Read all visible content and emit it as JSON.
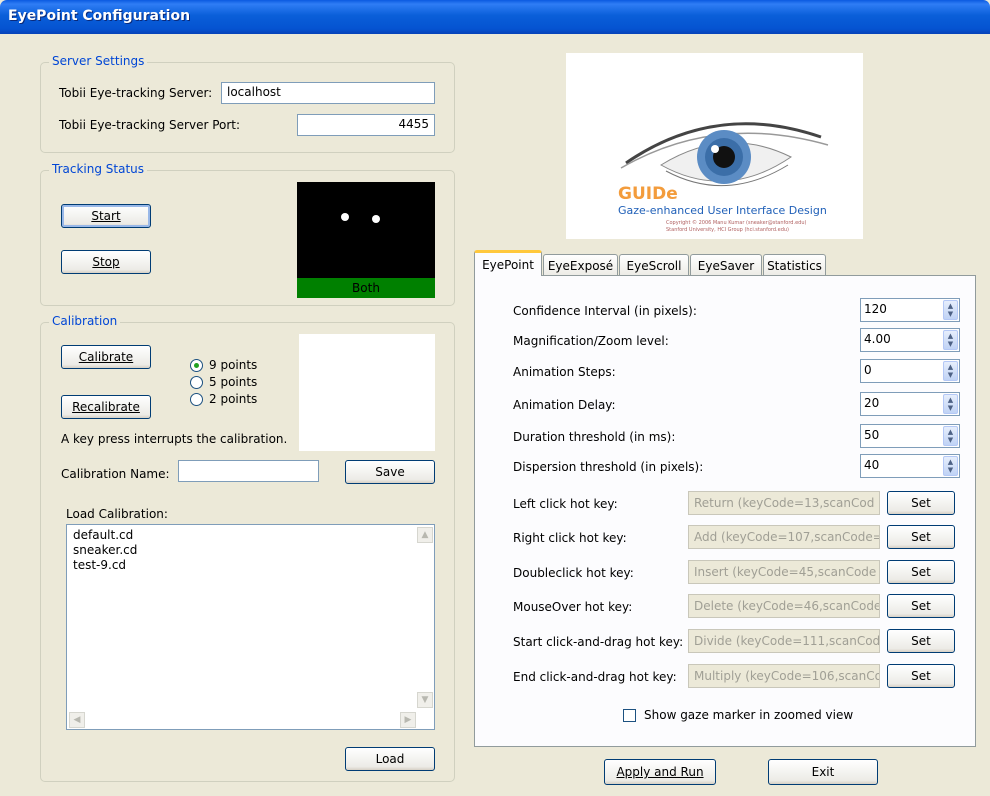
{
  "window": {
    "title": "EyePoint Configuration"
  },
  "server": {
    "legend": "Server Settings",
    "server_label": "Tobii Eye-tracking Server:",
    "server_value": "localhost",
    "port_label": "Tobii Eye-tracking Server Port:",
    "port_value": "4455"
  },
  "tracking": {
    "legend": "Tracking Status",
    "start_label": "Start",
    "stop_label": "Stop",
    "status_text": "Both",
    "status_color": "#008000"
  },
  "calibration": {
    "legend": "Calibration",
    "calibrate_label": "Calibrate",
    "recalibrate_label": "Recalibrate",
    "points": [
      "9 points",
      "5 points",
      "2 points"
    ],
    "selected_points": "9 points",
    "note": "A key press interrupts the calibration.",
    "name_label": "Calibration Name:",
    "name_value": "",
    "save_label": "Save",
    "load_label": "Load Calibration:",
    "files": [
      "default.cd",
      "sneaker.cd",
      "test-9.cd"
    ],
    "load_button": "Load"
  },
  "logo": {
    "title": "GUIDe",
    "subtitle": "Gaze-enhanced User Interface Design",
    "copyright": "Copyright © 2006 Manu Kumar (sneaker@stanford.edu)",
    "group": "Stanford University, HCI Group (hci.stanford.edu)"
  },
  "tabs": [
    "EyePoint",
    "EyeExposé",
    "EyeScroll",
    "EyeSaver",
    "Statistics"
  ],
  "active_tab": "EyePoint",
  "eyepoint": {
    "settings": [
      {
        "label": "Confidence Interval (in pixels):",
        "value": "120"
      },
      {
        "label": "Magnification/Zoom level:",
        "value": "4.00"
      },
      {
        "label": "Animation Steps:",
        "value": "0"
      },
      {
        "label": "Animation Delay:",
        "value": "20"
      },
      {
        "label": "Duration threshold (in ms):",
        "value": "50"
      },
      {
        "label": "Dispersion threshold (in pixels):",
        "value": "40"
      }
    ],
    "hotkeys": [
      {
        "label": "Left click hot key:",
        "value": "Return (keyCode=13,scanCod",
        "button": "Set"
      },
      {
        "label": "Right click hot key:",
        "value": "Add (keyCode=107,scanCode=",
        "button": "Set"
      },
      {
        "label": "Doubleclick hot key:",
        "value": "Insert (keyCode=45,scanCode",
        "button": "Set"
      },
      {
        "label": "MouseOver hot key:",
        "value": "Delete (keyCode=46,scanCode",
        "button": "Set"
      },
      {
        "label": "Start click-and-drag hot key:",
        "value": "Divide (keyCode=111,scanCod",
        "button": "Set"
      },
      {
        "label": "End click-and-drag hot key:",
        "value": "Multiply (keyCode=106,scanCo",
        "button": "Set"
      }
    ],
    "show_gaze_label": "Show gaze marker in zoomed view",
    "show_gaze_checked": false
  },
  "footer": {
    "apply_label": "Apply and Run",
    "exit_label": "Exit"
  }
}
